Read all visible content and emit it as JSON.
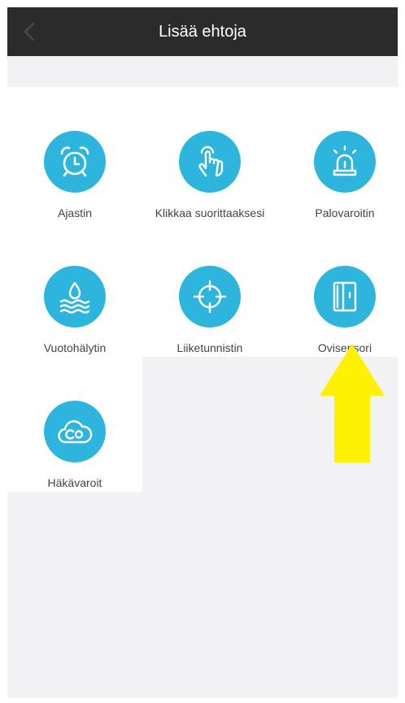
{
  "header": {
    "title": "Lisää ehtoja",
    "back_icon": "chevron-left-icon"
  },
  "conditions": [
    {
      "label": "Ajastin",
      "icon": "alarm-clock-icon"
    },
    {
      "label": "Klikkaa suorittaaksesi",
      "icon": "tap-hand-icon"
    },
    {
      "label": "Palovaroitin",
      "icon": "siren-alarm-icon"
    },
    {
      "label": "Vuotohälytin",
      "icon": "water-leak-icon"
    },
    {
      "label": "Liiketunnistin",
      "icon": "crosshair-icon"
    },
    {
      "label": "Ovisensori",
      "icon": "door-sensor-icon"
    },
    {
      "label": "Häkävaroit",
      "icon": "co-cloud-icon"
    }
  ],
  "annotation": {
    "arrow_color": "#fff200",
    "points_to": "Ovisensori"
  },
  "colors": {
    "navbar": "#2b2b2b",
    "icon_circle": "#2eb5dd",
    "page_bg": "#f2f2f5"
  }
}
